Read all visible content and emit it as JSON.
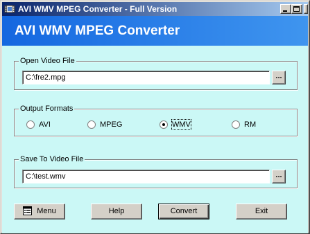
{
  "window": {
    "title": "AVI WMV MPEG Converter - Full Version",
    "app_icon": "film-icon",
    "controls": [
      "minimize-icon",
      "maximize-icon",
      "close-icon"
    ]
  },
  "banner": {
    "title": "AVI WMV MPEG Converter",
    "color": "#1467e0"
  },
  "content": {
    "background": "#cbf8f6"
  },
  "open_group": {
    "label": "Open Video File",
    "value": "C:\\fre2.mpg",
    "browse_label": "..."
  },
  "formats_group": {
    "label": "Output Formats",
    "options": [
      {
        "label": "AVI",
        "selected": false
      },
      {
        "label": "MPEG",
        "selected": false
      },
      {
        "label": "WMV",
        "selected": true
      },
      {
        "label": "RM",
        "selected": false
      }
    ]
  },
  "save_group": {
    "label": "Save To Video File",
    "value": "C:\\test.wmv",
    "browse_label": "..."
  },
  "buttons": {
    "menu": {
      "label": "Menu",
      "icon": "menu-list-icon"
    },
    "help": {
      "label": "Help"
    },
    "convert": {
      "label": "Convert"
    },
    "exit": {
      "label": "Exit"
    }
  }
}
